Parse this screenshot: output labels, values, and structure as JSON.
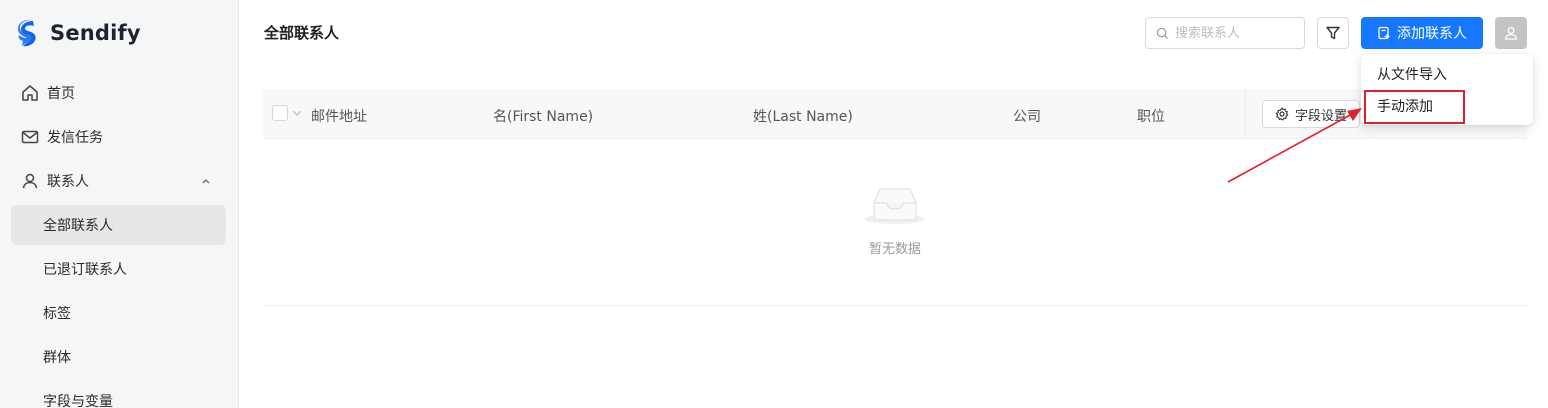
{
  "app": {
    "name": "Sendify"
  },
  "sidebar": {
    "items": [
      {
        "label": "首页",
        "icon": "home-icon"
      },
      {
        "label": "发信任务",
        "icon": "mail-icon"
      },
      {
        "label": "联系人",
        "icon": "user-icon",
        "expanded": true
      },
      {
        "label": "全部联系人",
        "active": true
      },
      {
        "label": "已退订联系人"
      },
      {
        "label": "标签"
      },
      {
        "label": "群体"
      },
      {
        "label": "字段与变量"
      }
    ]
  },
  "header": {
    "title": "全部联系人",
    "search_placeholder": "搜索联系人",
    "add_button": "添加联系人"
  },
  "dropdown": {
    "items": [
      "从文件导入",
      "手动添加"
    ],
    "highlighted": "手动添加"
  },
  "table": {
    "columns": [
      "邮件地址",
      "名(First Name)",
      "姓(Last Name)",
      "公司",
      "职位"
    ],
    "field_settings": "字段设置",
    "empty_text": "暂无数据"
  },
  "colors": {
    "primary": "#1677ff",
    "annotation": "#e02030",
    "sidebar_bg": "#f5f6f7",
    "active_bg": "#e6e7e9"
  }
}
